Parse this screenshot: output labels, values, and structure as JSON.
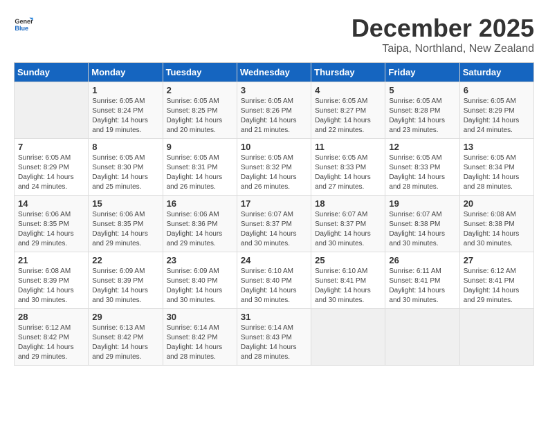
{
  "header": {
    "logo_general": "General",
    "logo_blue": "Blue",
    "month_title": "December 2025",
    "subtitle": "Taipa, Northland, New Zealand"
  },
  "days_of_week": [
    "Sunday",
    "Monday",
    "Tuesday",
    "Wednesday",
    "Thursday",
    "Friday",
    "Saturday"
  ],
  "weeks": [
    [
      {
        "day": "",
        "info": ""
      },
      {
        "day": "1",
        "info": "Sunrise: 6:05 AM\nSunset: 8:24 PM\nDaylight: 14 hours\nand 19 minutes."
      },
      {
        "day": "2",
        "info": "Sunrise: 6:05 AM\nSunset: 8:25 PM\nDaylight: 14 hours\nand 20 minutes."
      },
      {
        "day": "3",
        "info": "Sunrise: 6:05 AM\nSunset: 8:26 PM\nDaylight: 14 hours\nand 21 minutes."
      },
      {
        "day": "4",
        "info": "Sunrise: 6:05 AM\nSunset: 8:27 PM\nDaylight: 14 hours\nand 22 minutes."
      },
      {
        "day": "5",
        "info": "Sunrise: 6:05 AM\nSunset: 8:28 PM\nDaylight: 14 hours\nand 23 minutes."
      },
      {
        "day": "6",
        "info": "Sunrise: 6:05 AM\nSunset: 8:29 PM\nDaylight: 14 hours\nand 24 minutes."
      }
    ],
    [
      {
        "day": "7",
        "info": "Sunrise: 6:05 AM\nSunset: 8:29 PM\nDaylight: 14 hours\nand 24 minutes."
      },
      {
        "day": "8",
        "info": "Sunrise: 6:05 AM\nSunset: 8:30 PM\nDaylight: 14 hours\nand 25 minutes."
      },
      {
        "day": "9",
        "info": "Sunrise: 6:05 AM\nSunset: 8:31 PM\nDaylight: 14 hours\nand 26 minutes."
      },
      {
        "day": "10",
        "info": "Sunrise: 6:05 AM\nSunset: 8:32 PM\nDaylight: 14 hours\nand 26 minutes."
      },
      {
        "day": "11",
        "info": "Sunrise: 6:05 AM\nSunset: 8:33 PM\nDaylight: 14 hours\nand 27 minutes."
      },
      {
        "day": "12",
        "info": "Sunrise: 6:05 AM\nSunset: 8:33 PM\nDaylight: 14 hours\nand 28 minutes."
      },
      {
        "day": "13",
        "info": "Sunrise: 6:05 AM\nSunset: 8:34 PM\nDaylight: 14 hours\nand 28 minutes."
      }
    ],
    [
      {
        "day": "14",
        "info": "Sunrise: 6:06 AM\nSunset: 8:35 PM\nDaylight: 14 hours\nand 29 minutes."
      },
      {
        "day": "15",
        "info": "Sunrise: 6:06 AM\nSunset: 8:35 PM\nDaylight: 14 hours\nand 29 minutes."
      },
      {
        "day": "16",
        "info": "Sunrise: 6:06 AM\nSunset: 8:36 PM\nDaylight: 14 hours\nand 29 minutes."
      },
      {
        "day": "17",
        "info": "Sunrise: 6:07 AM\nSunset: 8:37 PM\nDaylight: 14 hours\nand 30 minutes."
      },
      {
        "day": "18",
        "info": "Sunrise: 6:07 AM\nSunset: 8:37 PM\nDaylight: 14 hours\nand 30 minutes."
      },
      {
        "day": "19",
        "info": "Sunrise: 6:07 AM\nSunset: 8:38 PM\nDaylight: 14 hours\nand 30 minutes."
      },
      {
        "day": "20",
        "info": "Sunrise: 6:08 AM\nSunset: 8:38 PM\nDaylight: 14 hours\nand 30 minutes."
      }
    ],
    [
      {
        "day": "21",
        "info": "Sunrise: 6:08 AM\nSunset: 8:39 PM\nDaylight: 14 hours\nand 30 minutes."
      },
      {
        "day": "22",
        "info": "Sunrise: 6:09 AM\nSunset: 8:39 PM\nDaylight: 14 hours\nand 30 minutes."
      },
      {
        "day": "23",
        "info": "Sunrise: 6:09 AM\nSunset: 8:40 PM\nDaylight: 14 hours\nand 30 minutes."
      },
      {
        "day": "24",
        "info": "Sunrise: 6:10 AM\nSunset: 8:40 PM\nDaylight: 14 hours\nand 30 minutes."
      },
      {
        "day": "25",
        "info": "Sunrise: 6:10 AM\nSunset: 8:41 PM\nDaylight: 14 hours\nand 30 minutes."
      },
      {
        "day": "26",
        "info": "Sunrise: 6:11 AM\nSunset: 8:41 PM\nDaylight: 14 hours\nand 30 minutes."
      },
      {
        "day": "27",
        "info": "Sunrise: 6:12 AM\nSunset: 8:41 PM\nDaylight: 14 hours\nand 29 minutes."
      }
    ],
    [
      {
        "day": "28",
        "info": "Sunrise: 6:12 AM\nSunset: 8:42 PM\nDaylight: 14 hours\nand 29 minutes."
      },
      {
        "day": "29",
        "info": "Sunrise: 6:13 AM\nSunset: 8:42 PM\nDaylight: 14 hours\nand 29 minutes."
      },
      {
        "day": "30",
        "info": "Sunrise: 6:14 AM\nSunset: 8:42 PM\nDaylight: 14 hours\nand 28 minutes."
      },
      {
        "day": "31",
        "info": "Sunrise: 6:14 AM\nSunset: 8:43 PM\nDaylight: 14 hours\nand 28 minutes."
      },
      {
        "day": "",
        "info": ""
      },
      {
        "day": "",
        "info": ""
      },
      {
        "day": "",
        "info": ""
      }
    ]
  ]
}
